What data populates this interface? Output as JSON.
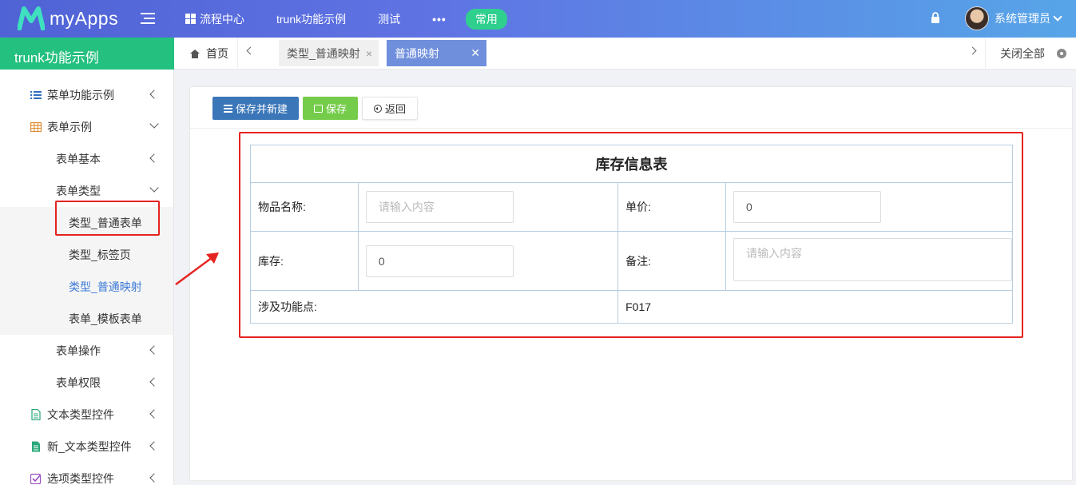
{
  "app": {
    "name": "myApps"
  },
  "topnav": {
    "items": [
      "流程中心",
      "trunk功能示例",
      "测试"
    ],
    "more": "•••",
    "pill": "常用"
  },
  "user": {
    "name": "系统管理员"
  },
  "sidebar": {
    "header": "trunk功能示例",
    "items": [
      {
        "label": "菜单功能示例"
      },
      {
        "label": "表单示例"
      },
      {
        "label": "表单基本"
      },
      {
        "label": "表单类型"
      },
      {
        "label": "类型_普通表单"
      },
      {
        "label": "类型_标签页"
      },
      {
        "label": "类型_普通映射"
      },
      {
        "label": "表单_模板表单"
      },
      {
        "label": "表单操作"
      },
      {
        "label": "表单权限"
      },
      {
        "label": "文本类型控件"
      },
      {
        "label": "新_文本类型控件"
      },
      {
        "label": "选项类型控件"
      }
    ]
  },
  "tabs": {
    "home": "首页",
    "items": [
      {
        "label": "类型_普通映射",
        "close": "×"
      },
      {
        "label": "普通映射",
        "close": "✕"
      }
    ],
    "close_all": "关闭全部"
  },
  "toolbar": {
    "save_new": "保存并新建",
    "save": "保存",
    "back": "返回"
  },
  "form": {
    "title": "库存信息表",
    "name_label": "物品名称:",
    "name_placeholder": "请输入内容",
    "price_label": "单价:",
    "price_value": "0",
    "stock_label": "库存:",
    "stock_value": "0",
    "remark_label": "备注:",
    "remark_placeholder": "请输入内容",
    "feature_label": "涉及功能点:",
    "feature_value": "F017"
  },
  "colors": {
    "topbar_start": "#4f63d6",
    "topbar_end": "#57a5e8",
    "sidebar_header": "#24c07f",
    "active_tab": "#6f8fdc",
    "highlight_red": "#e52320",
    "btn_primary": "#3a76b8",
    "btn_success": "#75cc4a"
  }
}
